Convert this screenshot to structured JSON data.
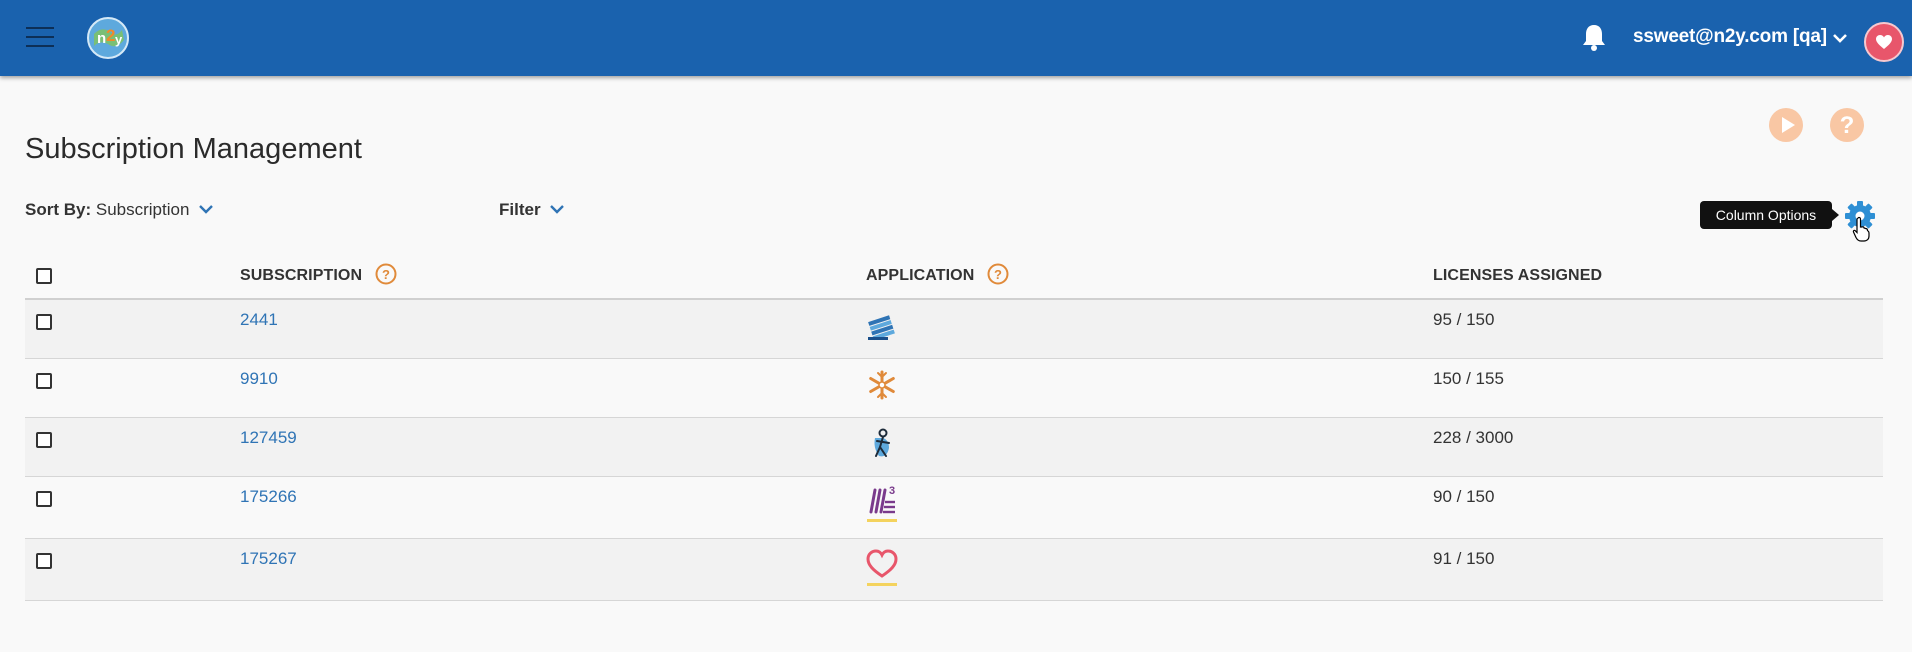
{
  "header": {
    "user_label": "ssweet@n2y.com [qa]",
    "brand_blue": "#1a62ae"
  },
  "page": {
    "title": "Subscription Management",
    "sort_by_label": "Sort By:",
    "sort_by_value": "Subscription",
    "filter_label": "Filter",
    "column_options_tooltip": "Column Options"
  },
  "table": {
    "columns": {
      "subscription": "SUBSCRIPTION",
      "application": "APPLICATION",
      "licenses": "LICENSES ASSIGNED"
    },
    "rows": [
      {
        "subscription": "2441",
        "app_icon": "books-icon",
        "licenses": "95 / 150"
      },
      {
        "subscription": "9910",
        "app_icon": "snowflake-icon",
        "licenses": "150 / 155"
      },
      {
        "subscription": "127459",
        "app_icon": "figure-icon",
        "licenses": "228 / 3000"
      },
      {
        "subscription": "175266",
        "app_icon": "l3-icon",
        "licenses": "90 / 150"
      },
      {
        "subscription": "175267",
        "app_icon": "heart-icon",
        "licenses": "91 / 150"
      }
    ]
  },
  "colors": {
    "link": "#2f74b5",
    "accent_orange": "#e08a3a",
    "gear_blue": "#2e8fd4",
    "avatar_pink": "#e8566b"
  }
}
